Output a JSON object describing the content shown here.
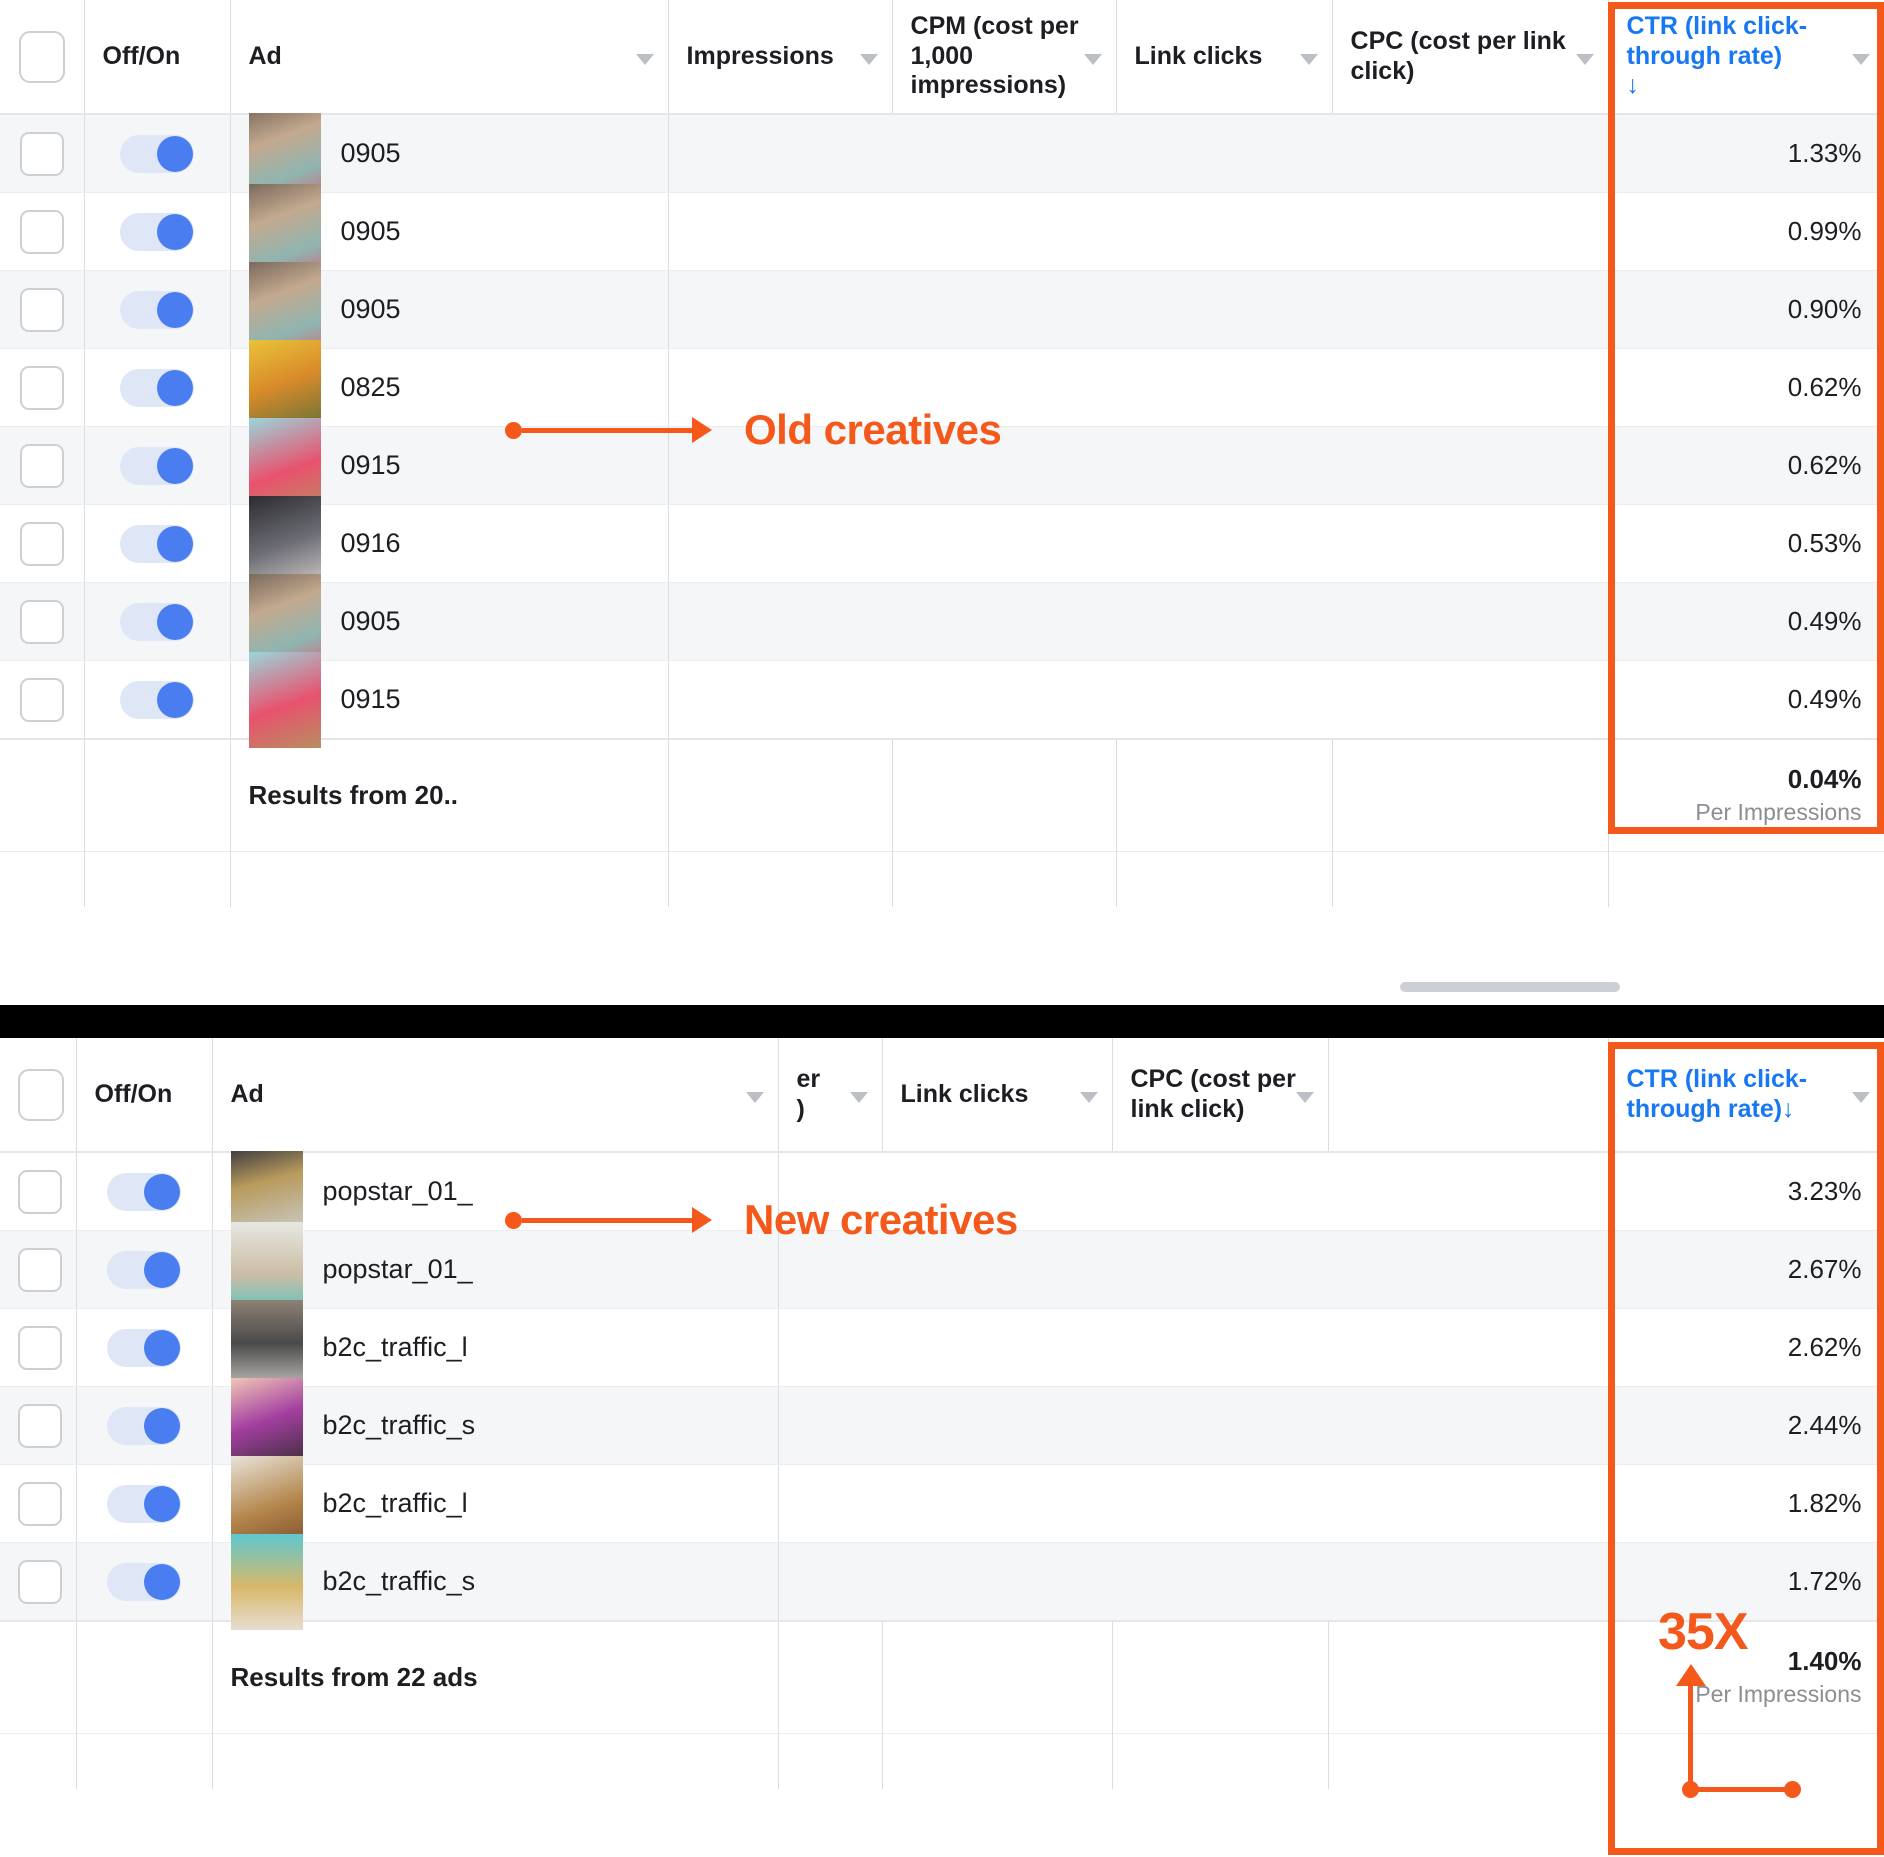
{
  "tables": {
    "top": {
      "columns": [
        {
          "label": "",
          "name": "select-all"
        },
        {
          "label": "Off/On",
          "name": "off-on"
        },
        {
          "label": "Ad",
          "name": "ad"
        },
        {
          "label": "Impressions",
          "name": "impressions"
        },
        {
          "label": "CPM (cost per 1,000 impressions)",
          "name": "cpm"
        },
        {
          "label": "Link clicks",
          "name": "link-clicks"
        },
        {
          "label": "CPC (cost per link click)",
          "name": "cpc"
        },
        {
          "label": "CTR (link click-through rate)",
          "name": "ctr"
        }
      ],
      "sort_indicator": "↓",
      "rows": [
        {
          "ad": "0905",
          "ctr": "1.33%",
          "toggle": "on"
        },
        {
          "ad": "0905",
          "ctr": "0.99%",
          "toggle": "on"
        },
        {
          "ad": "0905",
          "ctr": "0.90%",
          "toggle": "on"
        },
        {
          "ad": "0825",
          "ctr": "0.62%",
          "toggle": "on"
        },
        {
          "ad": "0915",
          "ctr": "0.62%",
          "toggle": "on"
        },
        {
          "ad": "0916",
          "ctr": "0.53%",
          "toggle": "on"
        },
        {
          "ad": "0905",
          "ctr": "0.49%",
          "toggle": "on"
        },
        {
          "ad": "0915",
          "ctr": "0.49%",
          "toggle": "on"
        }
      ],
      "summary": {
        "label": "Results from 20..",
        "ctr_value": "0.04%",
        "ctr_sub": "Per Impressions"
      }
    },
    "bottom": {
      "columns": [
        {
          "label": "",
          "name": "select-all"
        },
        {
          "label": "Off/On",
          "name": "off-on"
        },
        {
          "label": "Ad",
          "name": "ad"
        },
        {
          "label": "er\n)",
          "name": "cpm-cropped"
        },
        {
          "label": "Link clicks",
          "name": "link-clicks"
        },
        {
          "label": "CPC (cost per link click)",
          "name": "cpc"
        },
        {
          "label": "CTR (link click-through rate)",
          "name": "ctr"
        }
      ],
      "sort_indicator": "↓",
      "rows": [
        {
          "ad": "popstar_01_",
          "ctr": "3.23%",
          "toggle": "on"
        },
        {
          "ad": "popstar_01_",
          "ctr": "2.67%",
          "toggle": "on"
        },
        {
          "ad": "b2c_traffic_l",
          "ctr": "2.62%",
          "toggle": "on"
        },
        {
          "ad": "b2c_traffic_s",
          "ctr": "2.44%",
          "toggle": "on"
        },
        {
          "ad": "b2c_traffic_l",
          "ctr": "1.82%",
          "toggle": "on"
        },
        {
          "ad": "b2c_traffic_s",
          "ctr": "1.72%",
          "toggle": "on"
        }
      ],
      "summary": {
        "label": "Results from 22 ads",
        "ctr_value": "1.40%",
        "ctr_sub": "Per Impressions"
      }
    }
  },
  "annotations": {
    "old_creatives": "Old creatives",
    "new_creatives": "New creatives",
    "multiplier": "35X"
  },
  "colors": {
    "accent_orange": "#f4581a",
    "link_blue": "#1877f2",
    "toggle_blue": "#4a7ef0",
    "row_alt": "#f5f6f7"
  },
  "icons": {
    "column_menu": "chevron-down-icon",
    "sort_desc": "arrow-down-icon"
  }
}
